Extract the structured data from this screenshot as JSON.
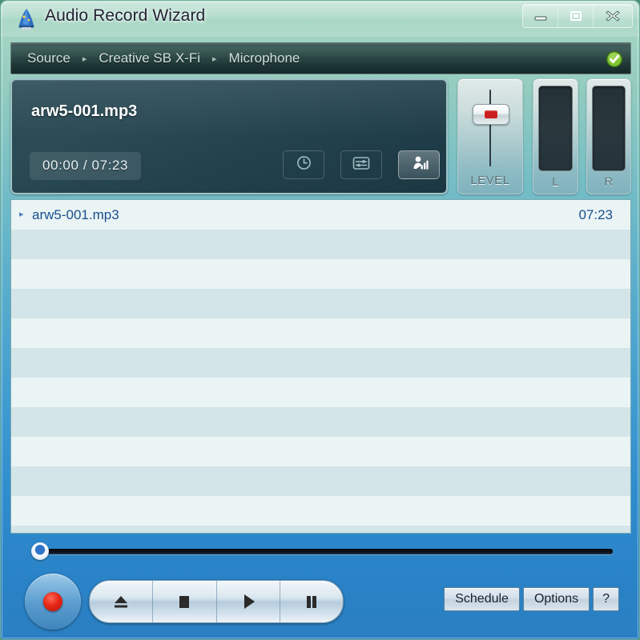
{
  "window": {
    "title": "Audio Record Wizard",
    "app_icon": "wizard-hat-icon",
    "controls": {
      "minimize": "minimize-icon",
      "maximize": "maximize-icon",
      "close": "close-icon"
    }
  },
  "breadcrumb": {
    "separator": "▸",
    "items": [
      "Source",
      "Creative SB X-Fi",
      "Microphone"
    ],
    "status_icon": "green-check-icon"
  },
  "display": {
    "track_title": "arw5-001.mp3",
    "time": "00:00 / 07:23",
    "buttons": [
      {
        "name": "timer-button",
        "icon": "clock-icon",
        "active": false
      },
      {
        "name": "format-button",
        "icon": "sliders-icon",
        "active": false
      },
      {
        "name": "input-level-button",
        "icon": "microphone-bars-icon",
        "active": true
      }
    ]
  },
  "level": {
    "label": "LEVEL",
    "thumb_color": "#cc1f1f"
  },
  "meters": [
    {
      "label": "L"
    },
    {
      "label": "R"
    }
  ],
  "playlist": {
    "rows": [
      {
        "marker": "▸",
        "name": "arw5-001.mp3",
        "duration": "07:23"
      },
      {
        "marker": "",
        "name": "",
        "duration": ""
      },
      {
        "marker": "",
        "name": "",
        "duration": ""
      },
      {
        "marker": "",
        "name": "",
        "duration": ""
      },
      {
        "marker": "",
        "name": "",
        "duration": ""
      },
      {
        "marker": "",
        "name": "",
        "duration": ""
      },
      {
        "marker": "",
        "name": "",
        "duration": ""
      },
      {
        "marker": "",
        "name": "",
        "duration": ""
      },
      {
        "marker": "",
        "name": "",
        "duration": ""
      },
      {
        "marker": "",
        "name": "",
        "duration": ""
      },
      {
        "marker": "",
        "name": "",
        "duration": ""
      },
      {
        "marker": "",
        "name": "",
        "duration": ""
      }
    ]
  },
  "transport": {
    "seek_position_percent": 0,
    "record": {
      "name": "record-button",
      "icon": "record-icon"
    },
    "buttons": [
      {
        "name": "eject-button",
        "icon": "eject-icon"
      },
      {
        "name": "stop-button",
        "icon": "stop-icon"
      },
      {
        "name": "play-button",
        "icon": "play-icon"
      },
      {
        "name": "pause-button",
        "icon": "pause-icon"
      }
    ]
  },
  "footer": {
    "schedule_label": "Schedule",
    "options_label": "Options",
    "help_label": "?"
  },
  "colors": {
    "frame_top": "#a9d8c4",
    "frame_bottom": "#2a7fc2",
    "display_bg": "#2a4a55",
    "record_red": "#e82717",
    "playlist_text": "#1a4f8e",
    "status_green": "#6db82a"
  }
}
